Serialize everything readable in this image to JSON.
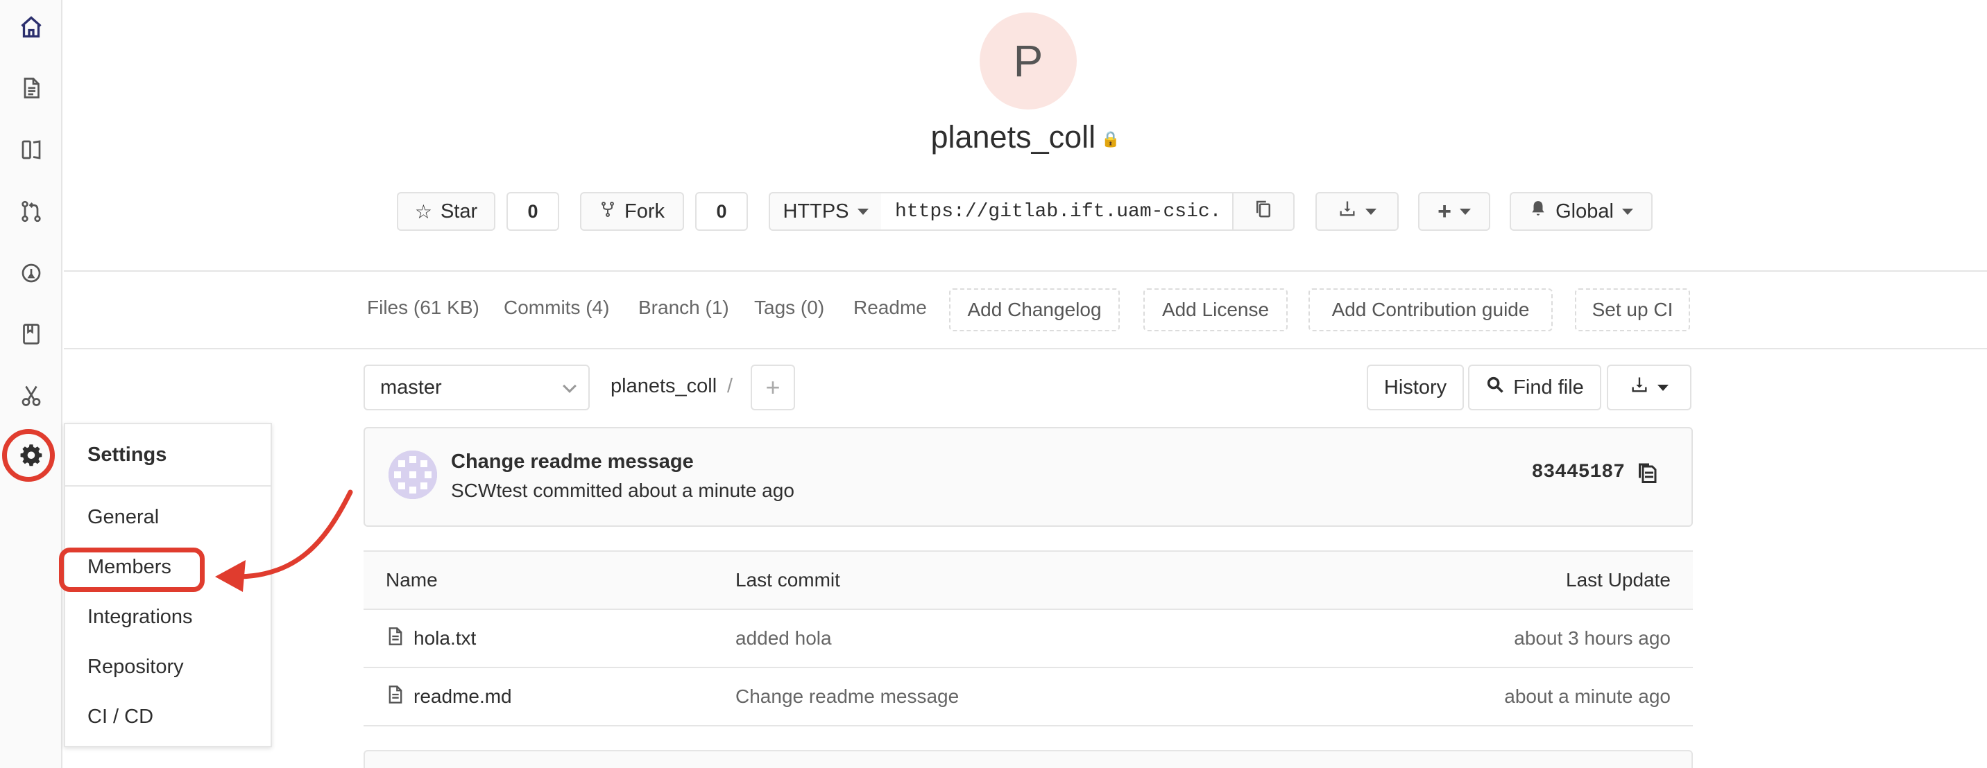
{
  "project": {
    "avatar_letter": "P",
    "name": "planets_coll",
    "lock": "🔒"
  },
  "actions": {
    "star_label": "Star",
    "star_count": "0",
    "fork_label": "Fork",
    "fork_count": "0",
    "protocol": "HTTPS",
    "clone_url": "https://gitlab.ift.uam-csic.",
    "notification_label": "Global"
  },
  "project_nav": {
    "files": "Files (61 KB)",
    "commits": "Commits (4)",
    "branch": "Branch (1)",
    "tags": "Tags (0)",
    "readme": "Readme",
    "add_changelog": "Add Changelog",
    "add_license": "Add License",
    "add_contribution": "Add Contribution guide",
    "setup_ci": "Set up CI"
  },
  "repo": {
    "branch": "master",
    "path_root": "planets_coll",
    "path_sep": "/",
    "history": "History",
    "find_file": "Find file"
  },
  "last_commit": {
    "title": "Change readme message",
    "meta": "SCWtest committed about a minute ago",
    "sha": "83445187"
  },
  "file_table": {
    "headers": {
      "name": "Name",
      "last_commit": "Last commit",
      "last_update": "Last Update"
    },
    "rows": [
      {
        "name": "hola.txt",
        "commit": "added hola",
        "updated": "about 3 hours ago"
      },
      {
        "name": "readme.md",
        "commit": "Change readme message",
        "updated": "about a minute ago"
      }
    ]
  },
  "settings_menu": {
    "title": "Settings",
    "items": [
      "General",
      "Members",
      "Integrations",
      "Repository",
      "CI / CD"
    ]
  },
  "colors": {
    "annotation": "#e03c2e",
    "avatar_bg": "#fbe5e1",
    "nav_active": "#2b2f6d"
  }
}
